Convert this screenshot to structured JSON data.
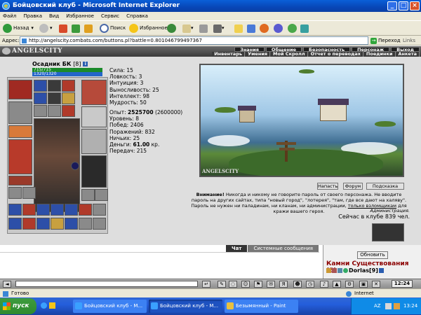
{
  "window": {
    "title": "Бойцовский клуб - Microsoft Internet Explorer"
  },
  "menu": [
    "Файл",
    "Правка",
    "Вид",
    "Избранное",
    "Сервис",
    "Справка"
  ],
  "toolbar": {
    "back": "Назад",
    "search": "Поиск",
    "favorites": "Избранное"
  },
  "address": {
    "label": "Адрес:",
    "url": "http://angelscity.combats.com/buttons.pl?battle=0.801046799497367",
    "go": "Переход",
    "links": "Links"
  },
  "game": {
    "logo": "ANGELSCITY",
    "nav_top": [
      "Знания",
      "Общение",
      "Безопасность",
      "Персонаж",
      "Выход"
    ],
    "nav_bottom": [
      "Инвентарь",
      "Умения",
      "Мой Скролл",
      "Отчет о переводах",
      "Поединки",
      "Анкета"
    ],
    "character": {
      "name": "Осадник БК",
      "level": "[8]",
      "info": "i",
      "hp": "715/715",
      "mp": "1320/1320"
    },
    "stats": [
      "Сила: 15",
      "Ловкость: 3",
      "Интуиция: 3",
      "Выносливость: 25",
      "Интеллект: 98",
      "Мудрость: 50"
    ],
    "record": {
      "exp_label": "Опыт:",
      "exp": "2525700",
      "exp_next": "(2600000)",
      "level": "Уровень: 8",
      "wins": "Побед: 2406",
      "losses": "Поражений: 832",
      "draws": "Ничьих: 25",
      "money_label": "Деньги:",
      "money": "61.00",
      "money_unit": "кр.",
      "transfers": "Передач: 215"
    },
    "scene_caption": "ANGELSCITY",
    "buttons": {
      "attack": "Напасть",
      "forum": "Форум",
      "hint": "Подсказка"
    },
    "warning": {
      "bold": "Внимание!",
      "text": " Никогда и никому не говорите пароль от своего персонажа. Не вводите пароль на других сайтах, типа \"новый город\", \"лотерея\", \"там, где все дают на халяву\". Пароль не нужен ни паладинам, ни кланам, ни администрации, ",
      "link": "только взломщикам",
      "tail": " для кражи вашего героя."
    },
    "admin": "Администрация.",
    "online": "Сейчас в клубе 839 чел."
  },
  "chat": {
    "tabs": [
      "Чат",
      "Системные сообщения"
    ],
    "refresh": "Обновить",
    "room": "Камни Существования (5)",
    "user": "Dorlas",
    "user_level": "[9]"
  },
  "gametool": {
    "time": "12:24"
  },
  "statusbar": {
    "ready": "Готово",
    "zone": "Internet"
  },
  "taskbar": {
    "start": "пуск",
    "tasks": [
      "Бойцовский клуб - M...",
      "Бойцовский клуб - M...",
      "Безымянный - Paint"
    ],
    "lang": "AZ",
    "clock": "13:24"
  },
  "colors": {
    "hp": "#1a8a2a",
    "mp": "#2466c8",
    "taskbar": "#245edb",
    "start": "#2f8a2f",
    "room_title": "#8b0000"
  }
}
